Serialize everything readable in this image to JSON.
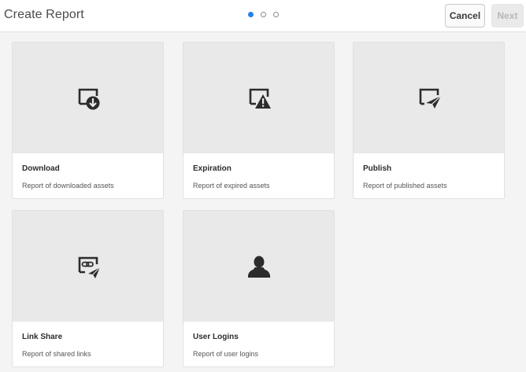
{
  "header": {
    "title": "Create Report",
    "steps": {
      "count": 3,
      "active_index": 0
    },
    "cancel_label": "Cancel",
    "next_label": "Next"
  },
  "colors": {
    "accent": "#2680eb",
    "card_thumb_bg": "#e9e9e9",
    "icon": "#2c2c2c"
  },
  "cards": [
    {
      "title": "Download",
      "description": "Report of downloaded assets",
      "icon": "download-report-icon"
    },
    {
      "title": "Expiration",
      "description": "Report of expired assets",
      "icon": "expiration-report-icon"
    },
    {
      "title": "Publish",
      "description": "Report of published assets",
      "icon": "publish-report-icon"
    },
    {
      "title": "Link Share",
      "description": "Report of shared links",
      "icon": "link-share-report-icon"
    },
    {
      "title": "User Logins",
      "description": "Report of user logins",
      "icon": "user-icon"
    }
  ]
}
